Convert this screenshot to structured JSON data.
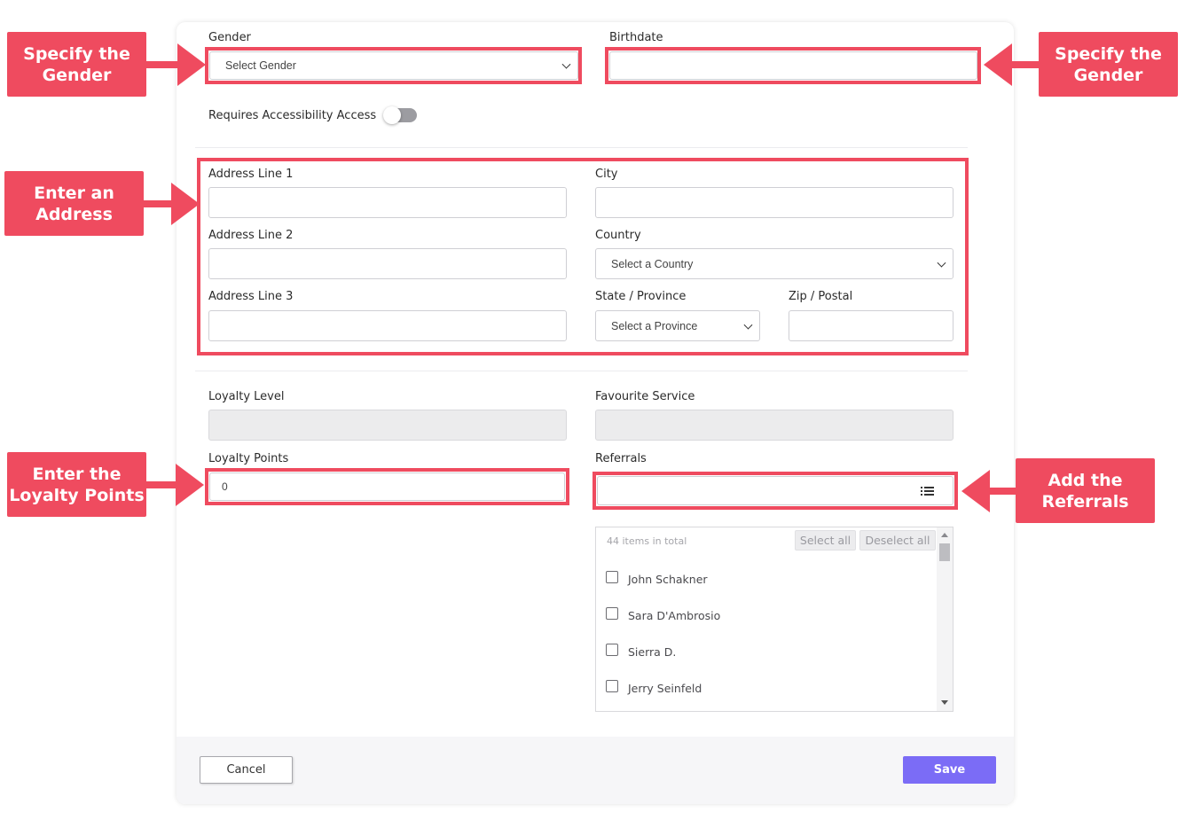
{
  "form": {
    "gender": {
      "label": "Gender",
      "value": "Select Gender"
    },
    "birthdate": {
      "label": "Birthdate",
      "value": ""
    },
    "accessibility": {
      "label": "Requires Accessibility Access",
      "enabled": false
    },
    "address_line_1": {
      "label": "Address Line 1",
      "value": ""
    },
    "address_line_2": {
      "label": "Address Line 2",
      "value": ""
    },
    "address_line_3": {
      "label": "Address Line 3",
      "value": ""
    },
    "city": {
      "label": "City",
      "value": ""
    },
    "country": {
      "label": "Country",
      "value": "Select a Country"
    },
    "state": {
      "label": "State / Province",
      "value": "Select a Province"
    },
    "zip": {
      "label": "Zip / Postal",
      "value": ""
    },
    "loyalty_level": {
      "label": "Loyalty Level",
      "value": ""
    },
    "favourite_service": {
      "label": "Favourite Service",
      "value": ""
    },
    "loyalty_points": {
      "label": "Loyalty Points",
      "value": "0"
    },
    "referrals": {
      "label": "Referrals",
      "total_text": "44 items in total",
      "select_all": "Select all",
      "deselect_all": "Deselect all",
      "items": [
        "John Schakner",
        "Sara D'Ambrosio",
        "Sierra D.",
        "Jerry Seinfeld"
      ]
    }
  },
  "footer": {
    "cancel_label": "Cancel",
    "save_label": "Save"
  },
  "callouts": {
    "gender": "Specify the\nGender",
    "birthdate": "Specify the\nGender",
    "address": "Enter an\nAddress",
    "loyalty_points": "Enter the\nLoyalty Points",
    "referrals": "Add the\nReferrals"
  },
  "colors": {
    "highlight": "#ef4b5f",
    "save_button": "#7b6cf6"
  }
}
